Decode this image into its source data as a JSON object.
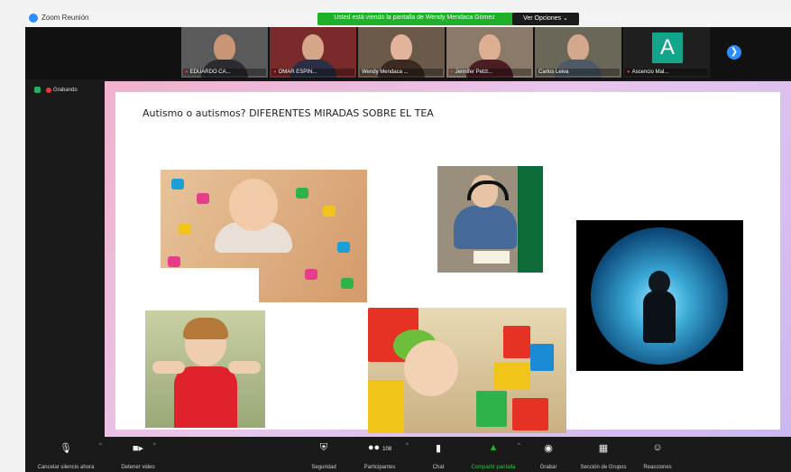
{
  "window": {
    "title": "Zoom Reunión"
  },
  "share_banner": {
    "text": "Usted está viendo la pantalla de Wendy Mendaca Gómez",
    "options_label": "Ver Opciones ⌄"
  },
  "participants": [
    {
      "name": "EDUARDO CA...",
      "muted": true
    },
    {
      "name": "OMAR ESPIN...",
      "muted": true
    },
    {
      "name": "Wendy Mendaca ...",
      "muted": false
    },
    {
      "name": "Jennifer Pelzt...",
      "muted": true
    },
    {
      "name": "Carlos Leiva",
      "muted": false
    },
    {
      "name": "Ascencio Mal...",
      "muted": true,
      "avatar_letter": "A",
      "avatar_color": "#12a589"
    }
  ],
  "recording": {
    "label": "Grabando"
  },
  "slide": {
    "title": "Autismo o autismos? DIFERENTES MIRADAS SOBRE EL TEA"
  },
  "toolbar": {
    "mute": "Cancelar silencio ahora",
    "video": "Detener video",
    "security": "Seguridad",
    "participants": "Participantes",
    "participants_count": "108",
    "chat": "Chat",
    "share": "Compartir pantalla",
    "record": "Grabar",
    "breakout": "Sección de Grupos",
    "reactions": "Reacciones"
  },
  "colors": {
    "zoom_blue": "#2d8cff",
    "share_green": "#1fb02a",
    "toolbar_bg": "#1a1a1a"
  }
}
